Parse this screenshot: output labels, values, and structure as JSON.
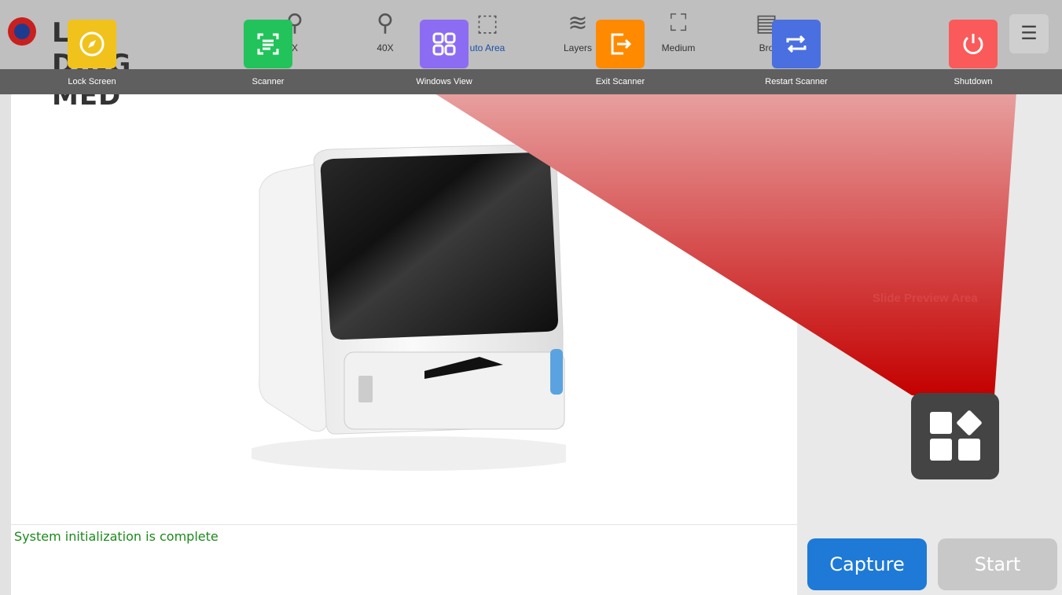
{
  "app": {
    "logo_text": "L    DING MED"
  },
  "toolbar": {
    "tools": [
      {
        "label": "X",
        "icon": "microscope-20x-icon"
      },
      {
        "label": "40X",
        "icon": "microscope-40x-icon"
      },
      {
        "label": "uto Area",
        "icon": "auto-area-icon"
      },
      {
        "label": "Layers",
        "icon": "layers-icon"
      },
      {
        "label": "Medium",
        "icon": "focus-medium-icon"
      },
      {
        "label": "Bro",
        "icon": "browse-icon"
      }
    ],
    "settings_icon": "settings-list-icon"
  },
  "quick_actions": [
    {
      "label": "Lock Screen",
      "color": "#f1c21b",
      "icon": "compass-icon"
    },
    {
      "label": "Scanner",
      "color": "#22c35a",
      "icon": "scan-icon"
    },
    {
      "label": "Windows View",
      "color": "#8b6cf3",
      "icon": "grid-icon"
    },
    {
      "label": "Exit Scanner",
      "color": "#ff8a00",
      "icon": "exit-icon"
    },
    {
      "label": "Restart Scanner",
      "color": "#4a6fe0",
      "icon": "restart-icon"
    },
    {
      "label": "Shutdown",
      "color": "#fa5a5a",
      "icon": "power-icon"
    }
  ],
  "main": {
    "status_text": "System initialization is complete"
  },
  "right_panel": {
    "preview_label": "Slide Preview Area"
  },
  "buttons": {
    "capture": "Capture",
    "start": "Start"
  }
}
